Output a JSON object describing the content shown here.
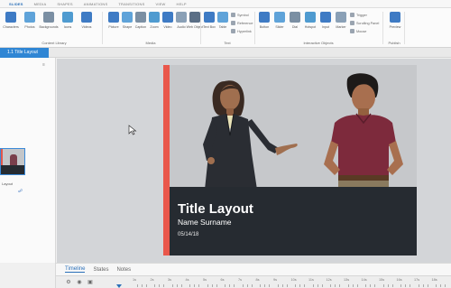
{
  "ribbon": {
    "tabs": [
      "Slides",
      "Media",
      "Shapes",
      "Animations",
      "Transitions",
      "View",
      "Help"
    ],
    "active_tab_index": 0,
    "buttons_characters": [
      {
        "label": "Characters",
        "icon": "characters-icon"
      },
      {
        "label": "Photos",
        "icon": "photos-icon"
      },
      {
        "label": "Backgrounds",
        "icon": "backgrounds-icon"
      },
      {
        "label": "Icons",
        "icon": "icons-icon"
      },
      {
        "label": "Videos",
        "icon": "videos-icon"
      }
    ],
    "group_content_library": "Content Library",
    "buttons_media": [
      {
        "label": "Picture",
        "icon": "picture-icon"
      },
      {
        "label": "Shape",
        "icon": "shape-icon"
      },
      {
        "label": "Caption",
        "icon": "caption-icon"
      },
      {
        "label": "Zoom",
        "icon": "zoom-icon"
      },
      {
        "label": "Video",
        "icon": "video-icon"
      },
      {
        "label": "Audio",
        "icon": "audio-icon"
      },
      {
        "label": "Web Object",
        "icon": "web-object-icon"
      }
    ],
    "group_media": "Media",
    "buttons_text": [
      {
        "label": "Text Box",
        "icon": "text-box-icon"
      },
      {
        "label": "Table",
        "icon": "table-icon"
      }
    ],
    "text_small": [
      "Symbol",
      "Reference",
      "Hyperlink"
    ],
    "group_text": "Text",
    "buttons_interactive": [
      {
        "label": "Button",
        "icon": "button-icon"
      },
      {
        "label": "Slider",
        "icon": "slider-icon"
      },
      {
        "label": "Dial",
        "icon": "dial-icon"
      },
      {
        "label": "Hotspot",
        "icon": "hotspot-icon"
      },
      {
        "label": "Input",
        "icon": "input-icon"
      },
      {
        "label": "Marker",
        "icon": "marker-icon"
      }
    ],
    "interactive_small": [
      "Trigger",
      "Scrolling Panel",
      "Mouse"
    ],
    "group_interactive": "Interactive Objects",
    "buttons_publish": [
      {
        "label": "Preview",
        "icon": "preview-icon"
      }
    ],
    "group_publish": "Publish"
  },
  "slide_tab": "1.1 Title Layout",
  "thumbnail": {
    "caption": "Layout",
    "link_icon": "link-icon"
  },
  "slide": {
    "title": "Title Layout",
    "subtitle": "Name Surname",
    "date": "05/14/18",
    "accent_color": "#e9574b",
    "bar_color": "#262b31"
  },
  "bottom_tabs": [
    "Timeline",
    "States",
    "Notes"
  ],
  "active_bottom_tab": 0,
  "timeline": {
    "ticks": [
      "1s",
      "2s",
      "3s",
      "4s",
      "5s",
      "6s",
      "7s",
      "8s",
      "9s",
      "10s",
      "11s",
      "12s",
      "13s",
      "14s",
      "15s",
      "16s",
      "17s",
      "18s"
    ]
  }
}
